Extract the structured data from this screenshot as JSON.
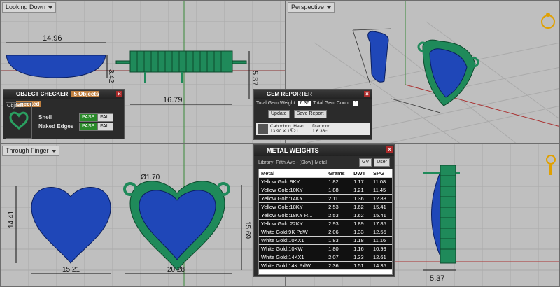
{
  "viewports": {
    "top": {
      "title": "Looking Down",
      "dims": [
        "14.96",
        "3.42",
        "5.37",
        "16.79"
      ]
    },
    "persp": {
      "title": "Perspective"
    },
    "front": {
      "title": "Through Finger",
      "dims": [
        "Ø1.70",
        "14.41",
        "15.21",
        "20.28",
        "15.69"
      ]
    },
    "right": {
      "dims": [
        "5.37"
      ]
    }
  },
  "object_checker": {
    "title": "OBJECT CHECKER",
    "checked_label": "5 Objects Checked",
    "objects_label": "Objects",
    "rows": [
      {
        "name": "Shell",
        "pass": "PASS",
        "fail": "FAIL"
      },
      {
        "name": "Naked Edges",
        "pass": "PASS",
        "fail": "FAIL"
      }
    ]
  },
  "gem_reporter": {
    "title": "GEM REPORTER",
    "total_weight_label": "Total Gem Weight:",
    "total_weight": "6.36",
    "total_count_label": "Total Gem Count:",
    "total_count": "1",
    "update_label": "Update",
    "save_label": "Save Report",
    "gem_name": "Cabochon_Heart",
    "gem_size": "13.90 X 15.21",
    "gem_type": "Diamond",
    "gem_count": "1",
    "gem_weight": "6.36ct"
  },
  "metal_weights": {
    "title": "METAL WEIGHTS",
    "library": "Library: Fifth Ave - (Slow)-Metal",
    "unit_btn": "GV",
    "user_btn": "User",
    "headers": [
      "Metal",
      "Grams",
      "DWT",
      "SPG"
    ],
    "rows": [
      [
        "Yellow Gold:9KY",
        "1.82",
        "1.17",
        "11.08"
      ],
      [
        "Yellow Gold:10KY",
        "1.88",
        "1.21",
        "11.45"
      ],
      [
        "Yellow Gold:14KY",
        "2.11",
        "1.36",
        "12.88"
      ],
      [
        "Yellow Gold:18KY",
        "2.53",
        "1.62",
        "15.41"
      ],
      [
        "Yellow Gold:18KY R...",
        "2.53",
        "1.62",
        "15.41"
      ],
      [
        "Yellow Gold:22KY",
        "2.93",
        "1.89",
        "17.85"
      ],
      [
        "White Gold:9K PdW",
        "2.06",
        "1.33",
        "12.55"
      ],
      [
        "White Gold:10KX1",
        "1.83",
        "1.18",
        "11.16"
      ],
      [
        "White Gold:10KW",
        "1.80",
        "1.16",
        "10.99"
      ],
      [
        "White Gold:14KX1",
        "2.07",
        "1.33",
        "12.61"
      ],
      [
        "White Gold:14K PdW",
        "2.36",
        "1.51",
        "14.35"
      ]
    ]
  },
  "colors": {
    "gem_blue": "#1f47b8",
    "metal_green": "#1f8a5a",
    "grid": "#a8a8a8"
  }
}
